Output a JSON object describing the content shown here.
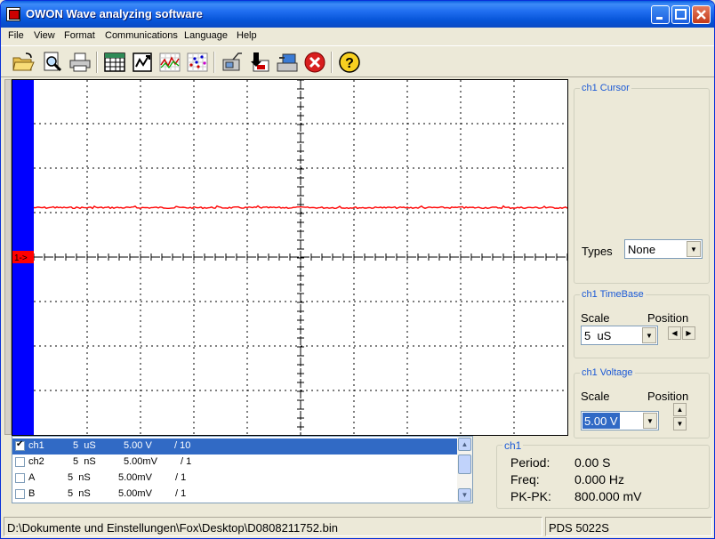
{
  "window": {
    "title": "OWON Wave analyzing software"
  },
  "menu": [
    {
      "label": "File"
    },
    {
      "label": "View"
    },
    {
      "label": "Format"
    },
    {
      "label": "Communications"
    },
    {
      "label": "Language"
    },
    {
      "label": "Help"
    }
  ],
  "toolbar": [
    {
      "name": "open-icon"
    },
    {
      "name": "preview-icon"
    },
    {
      "name": "print-icon"
    },
    {
      "name": "table-icon"
    },
    {
      "name": "export-icon"
    },
    {
      "name": "waveform-icon"
    },
    {
      "name": "scatter-icon"
    },
    {
      "name": "connect-icon"
    },
    {
      "name": "read-icon"
    },
    {
      "name": "device-icon"
    },
    {
      "name": "stop-icon"
    },
    {
      "name": "help-icon"
    }
  ],
  "scope": {
    "marker": "1->",
    "trace_color": "#ff0000"
  },
  "cursor": {
    "title": "ch1 Cursor",
    "types_label": "Types",
    "types_value": "None"
  },
  "timebase": {
    "title": "ch1 TimeBase",
    "scale_label": "Scale",
    "position_label": "Position",
    "scale_value": "5  uS"
  },
  "voltage": {
    "title": "ch1 Voltage",
    "scale_label": "Scale",
    "position_label": "Position",
    "scale_value": "5.00 V"
  },
  "channels": [
    {
      "checked": true,
      "name": "ch1",
      "time": "5  uS",
      "volt": "5.00 V",
      "ratio": "/ 10"
    },
    {
      "checked": false,
      "name": "ch2",
      "time": "5  nS",
      "volt": "5.00mV",
      "ratio": "/ 1"
    },
    {
      "checked": false,
      "name": "A",
      "time": "5  nS",
      "volt": "5.00mV",
      "ratio": "/ 1"
    },
    {
      "checked": false,
      "name": "B",
      "time": "5  nS",
      "volt": "5.00mV",
      "ratio": "/ 1"
    }
  ],
  "measure": {
    "title": "ch1",
    "period_label": "Period:",
    "period_value": "0.00 S",
    "freq_label": "Freq:",
    "freq_value": "0.000 Hz",
    "pkpk_label": "PK-PK:",
    "pkpk_value": "800.000 mV"
  },
  "status": {
    "path": "D:\\Dokumente und Einstellungen\\Fox\\Desktop\\D0808211752.bin",
    "model": "PDS 5022S"
  }
}
